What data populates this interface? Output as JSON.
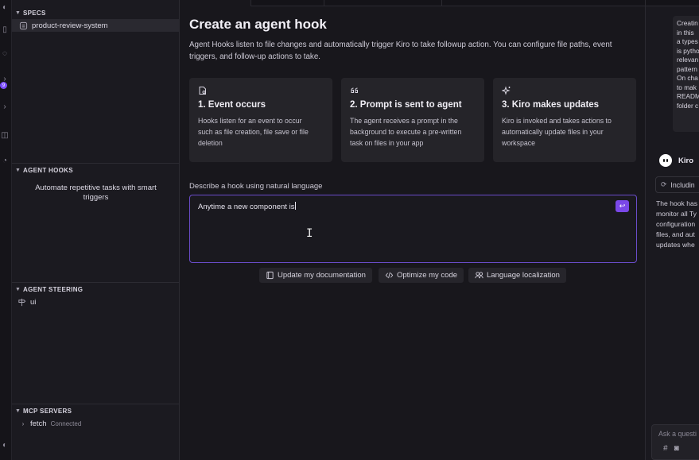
{
  "sidebar": {
    "specs": {
      "title": "SPECS",
      "items": [
        {
          "label": "product-review-system"
        }
      ]
    },
    "agent_hooks": {
      "title": "AGENT HOOKS",
      "empty_text_line1": "Automate repetitive tasks with smart",
      "empty_text_line2": "triggers"
    },
    "agent_steering": {
      "title": "AGENT STEERING",
      "items": [
        {
          "label": "ui"
        }
      ]
    },
    "mcp_servers": {
      "title": "MCP SERVERS",
      "items": [
        {
          "label": "fetch",
          "status": "Connected"
        }
      ]
    }
  },
  "main": {
    "title": "Create an agent hook",
    "description_line1": "Agent Hooks listen to file changes and automatically trigger Kiro to take followup action. You can configure file paths, event",
    "description_line2": "triggers, and follow-up actions to take.",
    "cards": [
      {
        "icon": "file-gear-icon",
        "title": "1. Event occurs",
        "lines": [
          "Hooks listen for an event to occur",
          "such as file creation, file save or file",
          "deletion"
        ]
      },
      {
        "icon": "quote-icon",
        "title": "2. Prompt is sent to agent",
        "lines": [
          "The agent receives a prompt in the",
          "background to execute a pre-written",
          "task on files in your app"
        ]
      },
      {
        "icon": "sparkles-icon",
        "title": "3. Kiro makes updates",
        "lines": [
          "Kiro is invoked and takes actions to",
          "automatically update files in your",
          "workspace"
        ]
      }
    ],
    "nl_label": "Describe a hook using natural language",
    "nl_value": "Anytime a new component is",
    "suggestions": [
      {
        "icon": "book-icon",
        "label": "Update my documentation"
      },
      {
        "icon": "code-icon",
        "label": "Optimize my code"
      },
      {
        "icon": "language-icon",
        "label": "Language localization"
      }
    ]
  },
  "chat": {
    "message_lines": [
      "Creatin",
      "in this",
      "a types",
      "is pytho",
      "relevan",
      "pattern",
      "On cha",
      "to mak",
      "READM",
      "folder c"
    ],
    "agent_name": "Kiro",
    "including_label": "Includin",
    "reply_lines": [
      "The hook has",
      "monitor all Ty",
      "configuration",
      "files, and aut",
      "updates whe"
    ],
    "input_placeholder": "Ask a questi"
  },
  "colors": {
    "accent": "#7a48e8",
    "background": "#18171c",
    "card": "#252429"
  }
}
